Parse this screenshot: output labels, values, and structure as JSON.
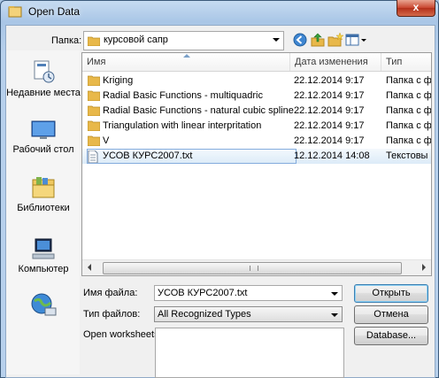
{
  "window": {
    "title": "Open Data",
    "close_glyph": "x"
  },
  "lookin": {
    "label": "Папка:",
    "value": "курсовой сапр"
  },
  "places": [
    {
      "label": "Недавние места",
      "icon": "recent-places-icon"
    },
    {
      "label": "Рабочий стол",
      "icon": "desktop-icon"
    },
    {
      "label": "Библиотеки",
      "icon": "libraries-icon"
    },
    {
      "label": "Компьютер",
      "icon": "computer-icon"
    },
    {
      "label": "",
      "icon": "network-icon"
    }
  ],
  "columns": {
    "name": "Имя",
    "date": "Дата изменения",
    "type": "Тип"
  },
  "files": [
    {
      "name": "Kriging",
      "date": "22.12.2014 9:17",
      "type": "Папка с ф",
      "kind": "folder"
    },
    {
      "name": "Radial Basic Functions - multiquadric",
      "date": "22.12.2014 9:17",
      "type": "Папка с ф",
      "kind": "folder"
    },
    {
      "name": "Radial Basic Functions - natural cubic spline",
      "date": "22.12.2014 9:17",
      "type": "Папка с ф",
      "kind": "folder"
    },
    {
      "name": "Triangulation with linear interpritation",
      "date": "22.12.2014 9:17",
      "type": "Папка с ф",
      "kind": "folder"
    },
    {
      "name": "V",
      "date": "22.12.2014 9:17",
      "type": "Папка с ф",
      "kind": "folder"
    },
    {
      "name": "УСОВ КУРС2007.txt",
      "date": "12.12.2014 14:08",
      "type": "Текстовы",
      "kind": "text"
    }
  ],
  "form": {
    "filename_label": "Имя файла:",
    "filename_value": "УСОВ КУРС2007.txt",
    "filetype_label": "Тип файлов:",
    "filetype_value": "All Recognized Types",
    "worksheets_label": "Open worksheets:"
  },
  "buttons": {
    "open": "Открыть",
    "cancel": "Отмена",
    "database": "Database..."
  },
  "colors": {
    "folder": "#e8b84a",
    "selection": "#dcebf8",
    "accent": "#3c7fb1"
  }
}
